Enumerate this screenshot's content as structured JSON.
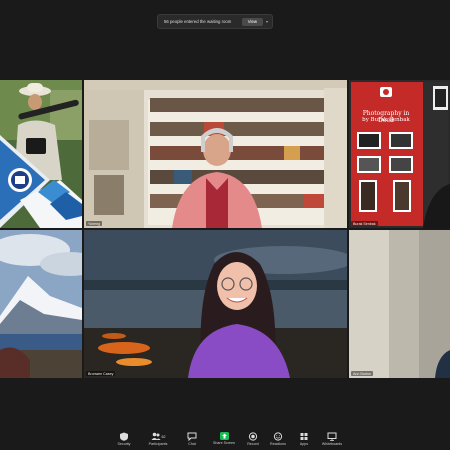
{
  "notification": {
    "text": "56 people entered the waiting room",
    "view_label": "View"
  },
  "participants": [
    {
      "id": "p1",
      "name": ""
    },
    {
      "id": "p2",
      "name": "Yoneng"
    },
    {
      "id": "p3",
      "name": "Burak Senbak"
    },
    {
      "id": "p4",
      "name": ""
    },
    {
      "id": "p5",
      "name": "Bronwen Casey"
    },
    {
      "id": "p6",
      "name": "Ann Barton"
    }
  ],
  "poster": {
    "title_line1": "Photography in Deed",
    "title_line2": "by Burak Şenbak"
  },
  "toolbar": {
    "items": [
      {
        "label": "Security",
        "icon": "shield-icon"
      },
      {
        "label": "Participants",
        "icon": "people-icon",
        "count": "62"
      },
      {
        "label": "Chat",
        "icon": "chat-icon"
      },
      {
        "label": "Share Screen",
        "icon": "share-screen-icon"
      },
      {
        "label": "Record",
        "icon": "record-icon"
      },
      {
        "label": "Reactions",
        "icon": "reactions-icon"
      },
      {
        "label": "Apps",
        "icon": "apps-icon"
      },
      {
        "label": "Whiteboards",
        "icon": "whiteboard-icon"
      }
    ]
  },
  "colors": {
    "background": "#1a1a1a",
    "active_speaker_border": "#e8e23a",
    "share_screen_green": "#1db954"
  }
}
